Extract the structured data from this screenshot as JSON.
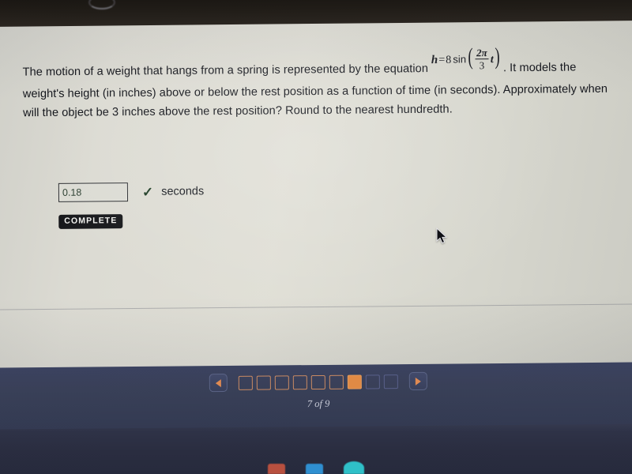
{
  "question": {
    "part1": "The motion of a weight that hangs from a spring is represented by the equation",
    "equation": {
      "lhs": "h",
      "equals": "=",
      "coefficient": "8",
      "function": "sin",
      "numerator": "2π",
      "denominator": "3",
      "variable": "t",
      "full_text": "h = 8 sin(2π/3 t)"
    },
    "part2": ". It models the weight's height (in inches) above or below the rest position as a function of time (in seconds). Approximately when will the object be 3 inches above the rest position? Round to the nearest hundredth."
  },
  "answer": {
    "value": "0.18",
    "placeholder": "",
    "status_icon": "✓",
    "unit_label": "seconds"
  },
  "actions": {
    "complete_label": "COMPLETE"
  },
  "pager": {
    "prev_label": "◀",
    "next_label": "▶",
    "page_count_label": "7 of 9",
    "current_page": 7,
    "total_pages": 9,
    "steps": [
      {
        "index": 1,
        "state": "visited"
      },
      {
        "index": 2,
        "state": "visited"
      },
      {
        "index": 3,
        "state": "visited"
      },
      {
        "index": 4,
        "state": "visited"
      },
      {
        "index": 5,
        "state": "visited"
      },
      {
        "index": 6,
        "state": "visited"
      },
      {
        "index": 7,
        "state": "current"
      },
      {
        "index": 8,
        "state": "locked"
      },
      {
        "index": 9,
        "state": "locked"
      }
    ]
  },
  "colors": {
    "accent_orange": "#e08a45",
    "footer_navy": "#394058",
    "page_background": "#dcdbd3",
    "check_green": "#1d3c24",
    "button_dark": "#17181b"
  }
}
